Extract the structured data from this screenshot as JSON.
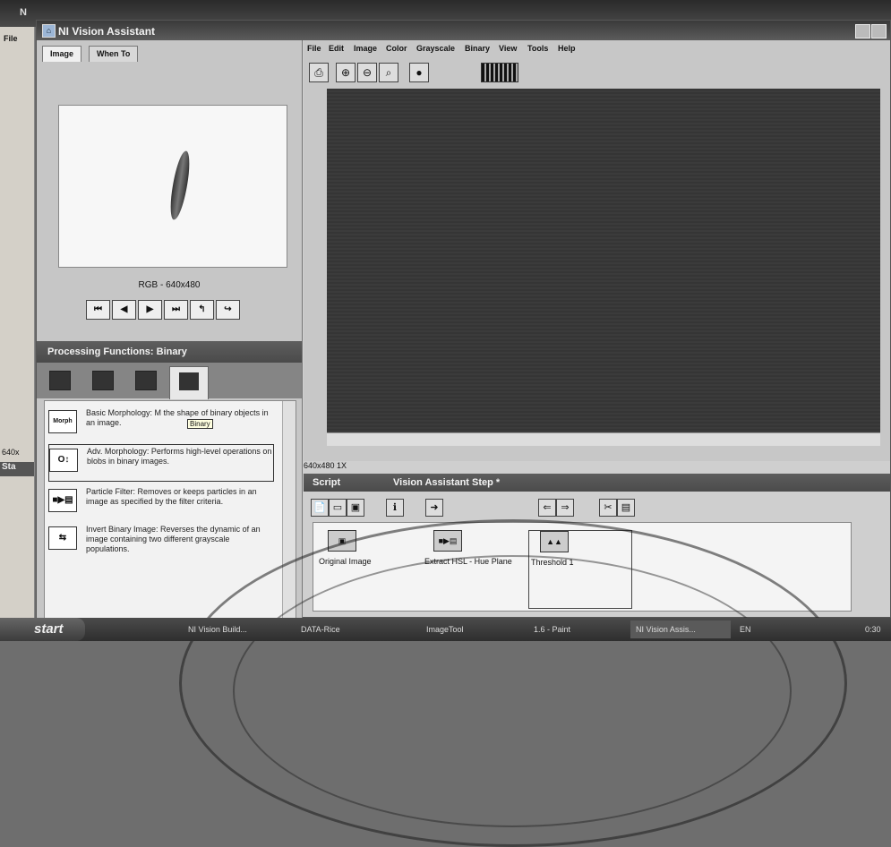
{
  "back_window": {
    "title": "N",
    "file_label": "File",
    "dim_label": "640x",
    "sta_label": "Sta"
  },
  "app": {
    "title": "NI Vision Assistant"
  },
  "left_tabs": [
    "Image",
    "When To"
  ],
  "preview": {
    "format_label": "RGB - 640x480"
  },
  "nav_buttons": [
    "⏮",
    "◀",
    "▶",
    "⏭",
    "↰",
    "↪"
  ],
  "processing": {
    "header": "Processing Functions: Binary",
    "tooltip": "Binary",
    "functions": [
      {
        "icon": "Morph",
        "name": "basic-morphology",
        "text": "Basic Morphology:  M          the shape of binary objects in an image."
      },
      {
        "icon": "O↕",
        "name": "adv-morphology",
        "text": "Adv. Morphology:  Performs high-level operations on blobs in binary images."
      },
      {
        "icon": "■▶▤",
        "name": "particle-filter",
        "text": "Particle Filter:  Removes or keeps particles in an image as specified by the filter criteria."
      },
      {
        "icon": "⇆",
        "name": "invert-binary",
        "text": "Invert Binary Image:  Reverses the dynamic of an image containing two different grayscale populations."
      }
    ]
  },
  "menu": [
    "File",
    "Edit",
    "Image",
    "Color",
    "Grayscale",
    "Binary",
    "View",
    "Tools",
    "Help"
  ],
  "toolbar_icons": [
    "printer-icon",
    "zoom-in-icon",
    "zoom-out-icon",
    "zoom-fit-icon",
    "color-icon"
  ],
  "image_view": {
    "dims": "640x480 1X"
  },
  "script": {
    "label": "Script",
    "step_label": "Vision Assistant Step *",
    "steps": [
      {
        "label": "Original Image",
        "icon": "▣"
      },
      {
        "label": "Extract HSL - Hue Plane",
        "icon": "■▶▤"
      },
      {
        "label": "Threshold 1",
        "icon": "▲▲"
      }
    ]
  },
  "taskbar": {
    "start": "start",
    "tasks": [
      "NI Vision Build...",
      "DATA-Rice",
      "ImageTool",
      "1.6 - Paint",
      "NI Vision Assis..."
    ],
    "tray_lang": "EN",
    "clock": "0:30"
  }
}
